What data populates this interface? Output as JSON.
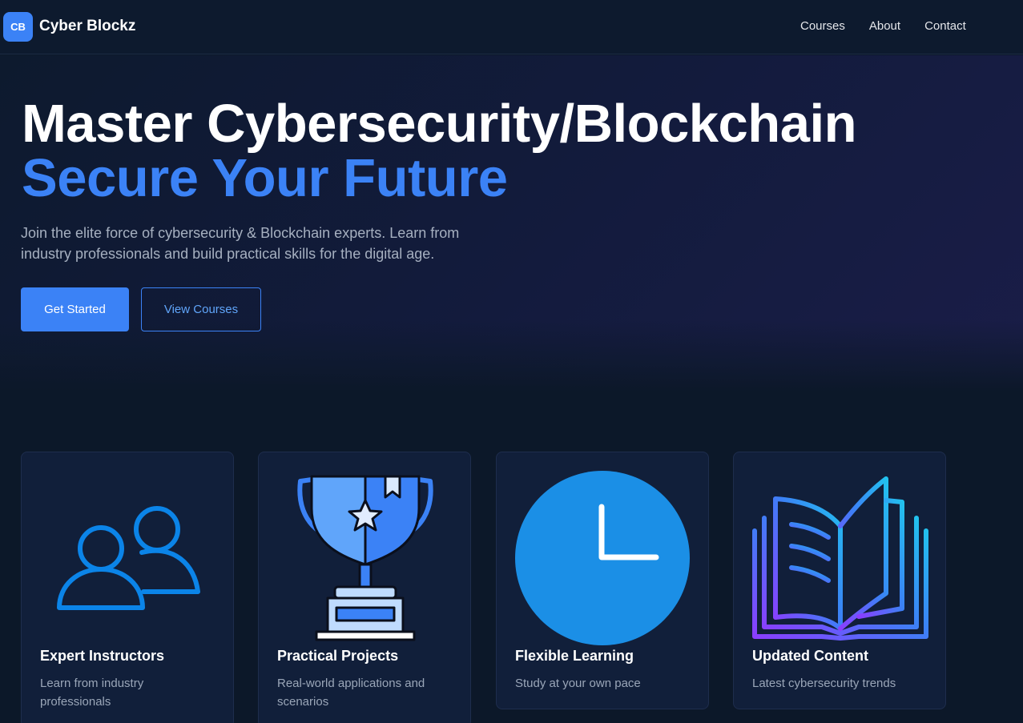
{
  "brand": {
    "logo_text": "CB",
    "name": "Cyber Blockz"
  },
  "nav": {
    "links": [
      "Courses",
      "About",
      "Contact"
    ]
  },
  "hero": {
    "title_line1": "Master Cybersecurity/Blockchain",
    "title_line2": "Secure Your Future",
    "subtitle": "Join the elite force of cybersecurity & Blockchain experts. Learn from industry professionals and build practical skills for the digital age.",
    "primary_button": "Get Started",
    "secondary_button": "View Courses"
  },
  "features": [
    {
      "icon": "users-icon",
      "title": "Expert Instructors",
      "description": "Learn from industry professionals"
    },
    {
      "icon": "trophy-icon",
      "title": "Practical Projects",
      "description": "Real-world applications and scenarios"
    },
    {
      "icon": "clock-icon",
      "title": "Flexible Learning",
      "description": "Study at your own pace"
    },
    {
      "icon": "book-icon",
      "title": "Updated Content",
      "description": "Latest cybersecurity trends"
    }
  ],
  "colors": {
    "accent": "#3b82f6",
    "background": "#0c1829",
    "card": "#111f3a",
    "text_muted": "#a6b0c0"
  }
}
